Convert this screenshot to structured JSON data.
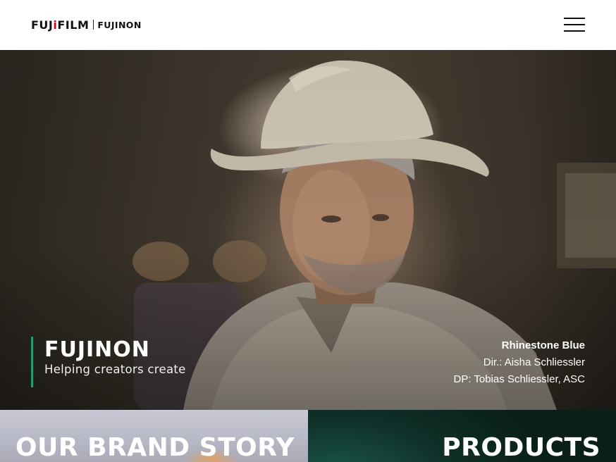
{
  "header": {
    "logo_primary": "FUJ!FILM",
    "logo_primary_a": "FUJ",
    "logo_primary_b": "i",
    "logo_primary_c": "FILM",
    "logo_secondary": "FUJINON",
    "menu_icon": "hamburger-menu-icon"
  },
  "hero": {
    "brand_name": "FUJINON",
    "tagline": "Helping creators create",
    "credits": {
      "title": "Rhinestone Blue",
      "director": "Dir.: Aisha Schliessler",
      "dp": "DP: Tobias Schliessler, ASC"
    }
  },
  "tiles": [
    {
      "label": "OUR BRAND STORY"
    },
    {
      "label": "PRODUCTS"
    }
  ],
  "colors": {
    "accent_green": "#1f9d6e",
    "logo_red": "#d6001c",
    "header_bg": "#ffffff"
  }
}
